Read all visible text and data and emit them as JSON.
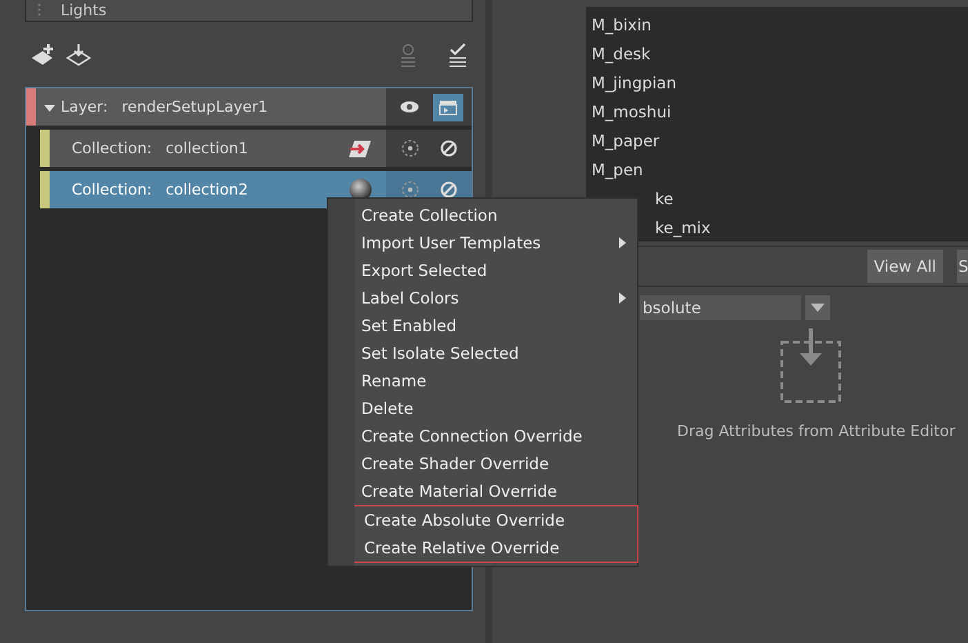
{
  "lights_row": {
    "label": "Lights"
  },
  "tree": {
    "layer": {
      "prefix": "Layer:",
      "name": "renderSetupLayer1",
      "expanded": true,
      "color": "#d97b7b",
      "visible": true,
      "renderable": true
    },
    "collections": [
      {
        "prefix": "Collection:",
        "name": "collection1",
        "color": "#c9c97e",
        "selected": false,
        "kind": "override"
      },
      {
        "prefix": "Collection:",
        "name": "collection2",
        "color": "#c9c97e",
        "selected": true,
        "kind": "material"
      }
    ]
  },
  "materials": [
    {
      "label": "M_bixin",
      "kind": "full"
    },
    {
      "label": "M_desk",
      "kind": "full"
    },
    {
      "label": "M_jingpian",
      "kind": "full"
    },
    {
      "label": "M_moshui",
      "kind": "full"
    },
    {
      "label": "M_paper",
      "kind": "full"
    },
    {
      "label": "M_pen",
      "kind": "full"
    },
    {
      "label": "ke",
      "kind": "cut"
    },
    {
      "label": "ke_mix",
      "kind": "cut"
    }
  ],
  "buttons": [
    "View All",
    "S"
  ],
  "override_type": {
    "value": "bsolute"
  },
  "drop_hint": "Drag Attributes from Attribute Editor",
  "context_menu": [
    {
      "label": "Create Collection",
      "submenu": false,
      "highlighted": false
    },
    {
      "label": "Import User Templates",
      "submenu": true,
      "highlighted": false
    },
    {
      "label": "Export Selected",
      "submenu": false,
      "highlighted": false
    },
    {
      "label": "Label Colors",
      "submenu": true,
      "highlighted": false
    },
    {
      "label": "Set Enabled",
      "submenu": false,
      "highlighted": false
    },
    {
      "label": "Set Isolate Selected",
      "submenu": false,
      "highlighted": false
    },
    {
      "label": "Rename",
      "submenu": false,
      "highlighted": false
    },
    {
      "label": "Delete",
      "submenu": false,
      "highlighted": false
    },
    {
      "label": "Create Connection Override",
      "submenu": false,
      "highlighted": false
    },
    {
      "label": "Create Shader Override",
      "submenu": false,
      "highlighted": false
    },
    {
      "label": "Create Material Override",
      "submenu": false,
      "highlighted": false
    },
    {
      "label": "Create Absolute Override",
      "submenu": false,
      "highlighted": true
    },
    {
      "label": "Create Relative Override",
      "submenu": false,
      "highlighted": true
    }
  ]
}
